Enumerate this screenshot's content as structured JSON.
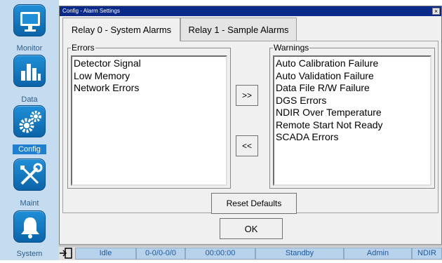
{
  "sidebar": {
    "items": [
      {
        "label": "Monitor",
        "icon": "monitor-icon"
      },
      {
        "label": "Data",
        "icon": "bar-chart-icon"
      },
      {
        "label": "Config",
        "icon": "gears-icon"
      },
      {
        "label": "Maint",
        "icon": "tools-icon"
      },
      {
        "label": "System",
        "icon": "bell-icon"
      }
    ],
    "active": "Config",
    "active_color": "#1f7fd0"
  },
  "window": {
    "title": "Config - Alarm Settings",
    "close_label": "×"
  },
  "tabs": [
    {
      "label": "Relay 0 - System Alarms",
      "active": true
    },
    {
      "label": "Relay 1 - Sample Alarms",
      "active": false
    }
  ],
  "errors": {
    "title": "Errors",
    "items": [
      "Detector Signal",
      "Low Memory",
      "Network Errors"
    ]
  },
  "warnings": {
    "title": "Warnings",
    "items": [
      "Auto Calibration Failure",
      "Auto Validation Failure",
      "Data File R/W Failure",
      "DGS Errors",
      "NDIR Over Temperature",
      "Remote Start Not Ready",
      "SCADA Errors"
    ]
  },
  "buttons": {
    "move_right": ">>",
    "move_left": "<<",
    "reset": "Reset Defaults",
    "ok": "OK"
  },
  "statusbar": {
    "state": "Idle",
    "stream": "0-0/0-0/0",
    "time": "00:00:00",
    "mode": "Standby",
    "user": "Admin",
    "detector": "NDIR"
  }
}
